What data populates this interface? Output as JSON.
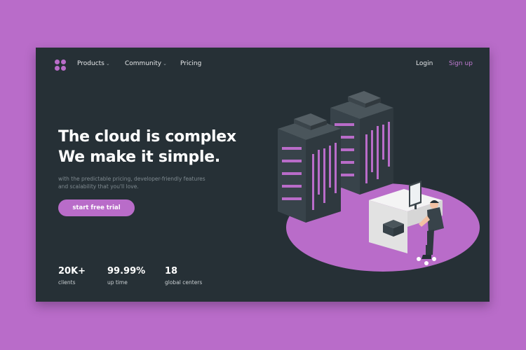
{
  "nav": {
    "logo": "clover-logo-icon",
    "items": [
      {
        "label": "Products",
        "dropdown": true
      },
      {
        "label": "Community",
        "dropdown": true
      },
      {
        "label": "Pricing",
        "dropdown": false
      }
    ],
    "chevron": "⌄",
    "login": "Login",
    "signup": "Sign up"
  },
  "hero": {
    "title_line1": "The cloud is complex",
    "title_line2": "We make it simple.",
    "subtitle_line1": "with the predictable pricing, developer-friendly features",
    "subtitle_line2": "and scalability that you'll love.",
    "cta": "start free trial"
  },
  "stats": [
    {
      "value": "20K+",
      "label": "clients"
    },
    {
      "value": "99.99%",
      "label": "up time"
    },
    {
      "value": "18",
      "label": "global centers"
    }
  ],
  "colors": {
    "background": "#b96cc9",
    "panel": "#263036",
    "accent": "#b96cc9",
    "text": "#ffffff",
    "muted": "#7f8a90"
  },
  "illustration": "server-racks-with-developer-at-desk"
}
